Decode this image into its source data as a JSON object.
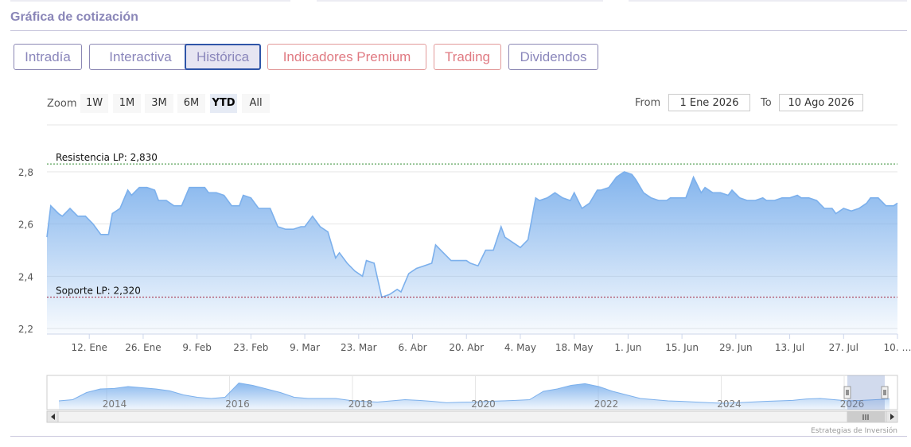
{
  "header": {
    "title": "Gráfica de cotización"
  },
  "tabs": [
    {
      "label": "Intradía",
      "active": false,
      "style": "normal"
    },
    {
      "label": "Interactiva",
      "active": false,
      "style": "normal"
    },
    {
      "label": "Histórica",
      "active": true,
      "style": "normal"
    },
    {
      "label": "Indicadores Premium",
      "active": false,
      "style": "red"
    },
    {
      "label": "Trading",
      "active": false,
      "style": "red"
    },
    {
      "label": "Dividendos",
      "active": false,
      "style": "normal"
    }
  ],
  "zoom": {
    "label": "Zoom",
    "buttons": [
      "1W",
      "1M",
      "3M",
      "6M",
      "YTD",
      "All"
    ],
    "selected": "YTD"
  },
  "range": {
    "from_label": "From",
    "from_value": "1 Ene 2026",
    "to_label": "To",
    "to_value": "10 Ago 2026"
  },
  "credit": "Estrategias de Inversión",
  "colors": {
    "line": "#7cb0ec",
    "resistance": "#2e8b2e",
    "support": "#a0203a",
    "accent": "#8a86b8"
  },
  "chart_data": {
    "type": "area",
    "x_ticks": [
      "12. Ene",
      "26. Ene",
      "9. Feb",
      "23. Feb",
      "9. Mar",
      "23. Mar",
      "6. Abr",
      "20. Abr",
      "4. May",
      "18. May",
      "1. Jun",
      "15. Jun",
      "29. Jun",
      "13. Jul",
      "27. Jul",
      "10. …"
    ],
    "y_ticks": [
      "2,2",
      "2,4",
      "2,6",
      "2,8"
    ],
    "ylim": [
      2.2,
      2.8
    ],
    "xlim": [
      "2026-01-01",
      "2026-08-10"
    ],
    "grid": true,
    "series": [
      {
        "values": [
          [
            "2026-01-01",
            2.55
          ],
          [
            "2026-01-02",
            2.67
          ],
          [
            "2026-01-04",
            2.64
          ],
          [
            "2026-01-05",
            2.63
          ],
          [
            "2026-01-07",
            2.66
          ],
          [
            "2026-01-09",
            2.63
          ],
          [
            "2026-01-11",
            2.63
          ],
          [
            "2026-01-13",
            2.6
          ],
          [
            "2026-01-15",
            2.56
          ],
          [
            "2026-01-17",
            2.56
          ],
          [
            "2026-01-18",
            2.64
          ],
          [
            "2026-01-20",
            2.66
          ],
          [
            "2026-01-22",
            2.73
          ],
          [
            "2026-01-23",
            2.71
          ],
          [
            "2026-01-25",
            2.74
          ],
          [
            "2026-01-27",
            2.74
          ],
          [
            "2026-01-29",
            2.73
          ],
          [
            "2026-01-30",
            2.69
          ],
          [
            "2026-02-01",
            2.69
          ],
          [
            "2026-02-03",
            2.67
          ],
          [
            "2026-02-05",
            2.67
          ],
          [
            "2026-02-07",
            2.74
          ],
          [
            "2026-02-09",
            2.74
          ],
          [
            "2026-02-11",
            2.74
          ],
          [
            "2026-02-12",
            2.72
          ],
          [
            "2026-02-14",
            2.72
          ],
          [
            "2026-02-16",
            2.71
          ],
          [
            "2026-02-18",
            2.67
          ],
          [
            "2026-02-20",
            2.67
          ],
          [
            "2026-02-21",
            2.71
          ],
          [
            "2026-02-23",
            2.7
          ],
          [
            "2026-02-25",
            2.66
          ],
          [
            "2026-02-27",
            2.66
          ],
          [
            "2026-02-28",
            2.66
          ],
          [
            "2026-03-02",
            2.59
          ],
          [
            "2026-03-04",
            2.58
          ],
          [
            "2026-03-06",
            2.58
          ],
          [
            "2026-03-08",
            2.59
          ],
          [
            "2026-03-09",
            2.59
          ],
          [
            "2026-03-11",
            2.63
          ],
          [
            "2026-03-13",
            2.59
          ],
          [
            "2026-03-15",
            2.57
          ],
          [
            "2026-03-17",
            2.47
          ],
          [
            "2026-03-18",
            2.49
          ],
          [
            "2026-03-20",
            2.45
          ],
          [
            "2026-03-22",
            2.42
          ],
          [
            "2026-03-24",
            2.4
          ],
          [
            "2026-03-25",
            2.46
          ],
          [
            "2026-03-27",
            2.45
          ],
          [
            "2026-03-29",
            2.32
          ],
          [
            "2026-03-31",
            2.33
          ],
          [
            "2026-04-02",
            2.35
          ],
          [
            "2026-04-03",
            2.34
          ],
          [
            "2026-04-05",
            2.41
          ],
          [
            "2026-04-07",
            2.43
          ],
          [
            "2026-04-09",
            2.44
          ],
          [
            "2026-04-11",
            2.45
          ],
          [
            "2026-04-12",
            2.52
          ],
          [
            "2026-04-14",
            2.49
          ],
          [
            "2026-04-16",
            2.46
          ],
          [
            "2026-04-18",
            2.46
          ],
          [
            "2026-04-20",
            2.46
          ],
          [
            "2026-04-21",
            2.45
          ],
          [
            "2026-04-23",
            2.44
          ],
          [
            "2026-04-25",
            2.5
          ],
          [
            "2026-04-27",
            2.5
          ],
          [
            "2026-04-29",
            2.59
          ],
          [
            "2026-04-30",
            2.55
          ],
          [
            "2026-05-02",
            2.53
          ],
          [
            "2026-05-04",
            2.51
          ],
          [
            "2026-05-06",
            2.54
          ],
          [
            "2026-05-08",
            2.7
          ],
          [
            "2026-05-09",
            2.69
          ],
          [
            "2026-05-11",
            2.7
          ],
          [
            "2026-05-13",
            2.72
          ],
          [
            "2026-05-15",
            2.7
          ],
          [
            "2026-05-17",
            2.69
          ],
          [
            "2026-05-18",
            2.72
          ],
          [
            "2026-05-20",
            2.66
          ],
          [
            "2026-05-22",
            2.68
          ],
          [
            "2026-05-24",
            2.73
          ],
          [
            "2026-05-25",
            2.73
          ],
          [
            "2026-05-27",
            2.74
          ],
          [
            "2026-05-29",
            2.78
          ],
          [
            "2026-05-31",
            2.8
          ],
          [
            "2026-06-02",
            2.79
          ],
          [
            "2026-06-03",
            2.77
          ],
          [
            "2026-06-05",
            2.72
          ],
          [
            "2026-06-07",
            2.7
          ],
          [
            "2026-06-09",
            2.69
          ],
          [
            "2026-06-11",
            2.69
          ],
          [
            "2026-06-12",
            2.7
          ],
          [
            "2026-06-14",
            2.7
          ],
          [
            "2026-06-16",
            2.7
          ],
          [
            "2026-06-18",
            2.78
          ],
          [
            "2026-06-20",
            2.72
          ],
          [
            "2026-06-21",
            2.74
          ],
          [
            "2026-06-23",
            2.72
          ],
          [
            "2026-06-25",
            2.72
          ],
          [
            "2026-06-27",
            2.71
          ],
          [
            "2026-06-28",
            2.73
          ],
          [
            "2026-06-30",
            2.7
          ],
          [
            "2026-07-02",
            2.69
          ],
          [
            "2026-07-04",
            2.69
          ],
          [
            "2026-07-06",
            2.7
          ],
          [
            "2026-07-07",
            2.69
          ],
          [
            "2026-07-09",
            2.69
          ],
          [
            "2026-07-11",
            2.7
          ],
          [
            "2026-07-13",
            2.7
          ],
          [
            "2026-07-15",
            2.71
          ],
          [
            "2026-07-16",
            2.7
          ],
          [
            "2026-07-18",
            2.7
          ],
          [
            "2026-07-20",
            2.69
          ],
          [
            "2026-07-22",
            2.66
          ],
          [
            "2026-07-24",
            2.66
          ],
          [
            "2026-07-25",
            2.64
          ],
          [
            "2026-07-27",
            2.66
          ],
          [
            "2026-07-29",
            2.65
          ],
          [
            "2026-07-31",
            2.66
          ],
          [
            "2026-08-02",
            2.68
          ],
          [
            "2026-08-03",
            2.7
          ],
          [
            "2026-08-05",
            2.7
          ],
          [
            "2026-08-07",
            2.67
          ],
          [
            "2026-08-09",
            2.67
          ],
          [
            "2026-08-10",
            2.68
          ]
        ]
      }
    ],
    "annotations": [
      {
        "label": "Resistencia LP: 2,830",
        "value": 2.83,
        "kind": "resistance"
      },
      {
        "label": "Soporte LP: 2,320",
        "value": 2.32,
        "kind": "support"
      }
    ],
    "navigator": {
      "x_ticks": [
        "2014",
        "2016",
        "2018",
        "2020",
        "2022",
        "2024",
        "2026"
      ],
      "values": [
        0.2,
        0.25,
        0.55,
        0.7,
        0.72,
        0.8,
        0.75,
        0.7,
        0.62,
        0.45,
        0.35,
        0.3,
        0.35,
        0.95,
        0.85,
        0.7,
        0.55,
        0.35,
        0.3,
        0.3,
        0.3,
        0.22,
        0.18,
        0.15,
        0.2,
        0.25,
        0.22,
        0.18,
        0.12,
        0.14,
        0.15,
        0.18,
        0.2,
        0.22,
        0.25,
        0.6,
        0.7,
        0.85,
        0.92,
        0.8,
        0.6,
        0.45,
        0.3,
        0.25,
        0.2,
        0.18,
        0.15,
        0.12,
        0.1,
        0.12,
        0.15,
        0.18,
        0.2,
        0.22,
        0.28,
        0.3,
        0.25,
        0.2,
        0.22,
        0.25,
        0.28
      ]
    }
  }
}
